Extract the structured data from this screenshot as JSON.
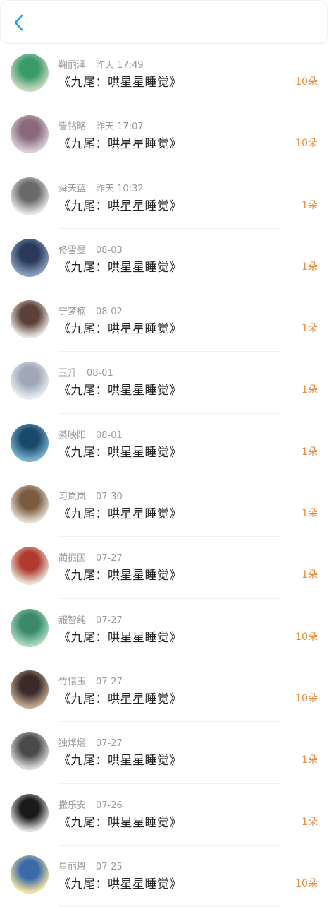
{
  "header": {
    "back_icon": "chevron-left-icon",
    "accent": "#2a9ee8"
  },
  "colors": {
    "amount": "#e98a3a",
    "meta": "#9a9a9a",
    "title": "#222222"
  },
  "items": [
    {
      "name": "鞠丽泽",
      "time": "昨天 17:49",
      "title": "《九尾：哄星星睡觉》",
      "amount": "10朵",
      "avatar_colors": [
        "#3a9a6a",
        "#c8d8c0"
      ]
    },
    {
      "name": "訾铭略",
      "time": "昨天 17:07",
      "title": "《九尾：哄星星睡觉》",
      "amount": "10朵",
      "avatar_colors": [
        "#8a6a7a",
        "#d9cfd8"
      ]
    },
    {
      "name": "舜天蓝",
      "time": "昨天 10:32",
      "title": "《九尾：哄星星睡觉》",
      "amount": "1朵",
      "avatar_colors": [
        "#6a6a6a",
        "#e6e6e6"
      ]
    },
    {
      "name": "佟雪曼",
      "time": "08-03",
      "title": "《九尾：哄星星睡觉》",
      "amount": "1朵",
      "avatar_colors": [
        "#2a3a5a",
        "#8aa0c0"
      ]
    },
    {
      "name": "宁梦楠",
      "time": "08-02",
      "title": "《九尾：哄星星睡觉》",
      "amount": "1朵",
      "avatar_colors": [
        "#5a4038",
        "#e8e2de"
      ]
    },
    {
      "name": "玉升",
      "time": "08-01",
      "title": "《九尾：哄星星睡觉》",
      "amount": "1朵",
      "avatar_colors": [
        "#a0a8b8",
        "#e8ecf2"
      ]
    },
    {
      "name": "綦映阳",
      "time": "08-01",
      "title": "《九尾：哄星星睡觉》",
      "amount": "1朵",
      "avatar_colors": [
        "#1a4a6a",
        "#7ab0d0"
      ]
    },
    {
      "name": "习岚岚",
      "time": "07-30",
      "title": "《九尾：哄星星睡觉》",
      "amount": "1朵",
      "avatar_colors": [
        "#7a5a40",
        "#e4dcd2"
      ]
    },
    {
      "name": "蔺振国",
      "time": "07-27",
      "title": "《九尾：哄星星睡觉》",
      "amount": "1朵",
      "avatar_colors": [
        "#b03a30",
        "#e8e0d0"
      ]
    },
    {
      "name": "赧智纯",
      "time": "07-27",
      "title": "《九尾：哄星星睡觉》",
      "amount": "10朵",
      "avatar_colors": [
        "#3a8a6a",
        "#a8d8c0"
      ]
    },
    {
      "name": "竹惜玉",
      "time": "07-27",
      "title": "《九尾：哄星星睡觉》",
      "amount": "10朵",
      "avatar_colors": [
        "#3a2a2a",
        "#c0a890"
      ]
    },
    {
      "name": "独烨熠",
      "time": "07-27",
      "title": "《九尾：哄星星睡觉》",
      "amount": "1朵",
      "avatar_colors": [
        "#4a4a4a",
        "#d8d8d8"
      ]
    },
    {
      "name": "撒乐安",
      "time": "07-26",
      "title": "《九尾：哄星星睡觉》",
      "amount": "1朵",
      "avatar_colors": [
        "#1a1a1a",
        "#dcdcdc"
      ]
    },
    {
      "name": "星丽恩",
      "time": "07-25",
      "title": "《九尾：哄星星睡觉》",
      "amount": "10朵",
      "avatar_colors": [
        "#3a6aa8",
        "#f0e0a0"
      ]
    }
  ]
}
